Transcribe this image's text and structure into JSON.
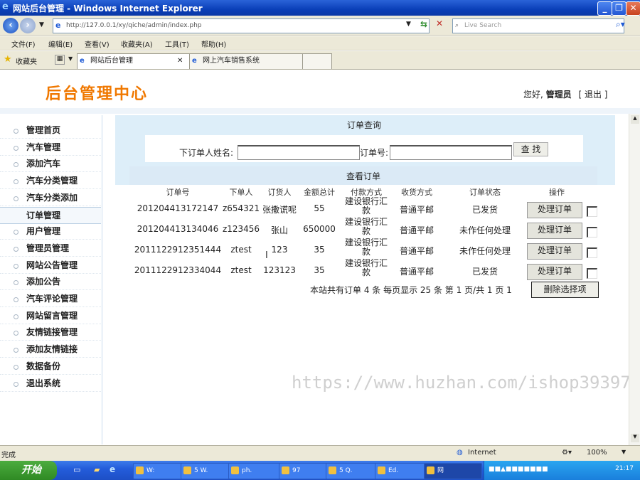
{
  "window": {
    "title": "网站后台管理 - Windows Internet Explorer"
  },
  "addressbar": {
    "url": "http://127.0.0.1/xy/qiche/admin/index.php",
    "search_placeholder": "Live Search"
  },
  "menu": [
    "文件(F)",
    "编辑(E)",
    "查看(V)",
    "收藏夹(A)",
    "工具(T)",
    "帮助(H)"
  ],
  "favorites_label": "收藏夹",
  "tabs": [
    "网站后台管理",
    "网上汽车销售系统"
  ],
  "header": {
    "logo": "后台管理中心",
    "greeting": "您好,",
    "user": "管理员",
    "logout": "[ 退出 ]"
  },
  "sidebar": {
    "items": [
      "管理首页",
      "汽车管理",
      "添加汽车",
      "汽车分类管理",
      "汽车分类添加",
      "订单管理",
      "用户管理",
      "管理员管理",
      "网站公告管理",
      "添加公告",
      "汽车评论管理",
      "网站留言管理",
      "友情链接管理",
      "添加友情链接",
      "数据备份",
      "退出系统"
    ],
    "active_index": 5
  },
  "query": {
    "title": "订单查询",
    "name_label": "下订单人姓名:",
    "order_label": "订单号:",
    "search_button": "查 找"
  },
  "orders": {
    "title": "查看订单",
    "columns": [
      "订单号",
      "下单人",
      "订货人",
      "金额总计",
      "付款方式",
      "收货方式",
      "订单状态",
      "操作"
    ],
    "rows": [
      [
        "201204413172147",
        "z654321",
        "张撒谎呢",
        "55",
        "建设银行汇款",
        "普通平邮",
        "已发货",
        "处理订单"
      ],
      [
        "201204413134046",
        "z123456",
        "张山",
        "650000",
        "建设银行汇款",
        "普通平邮",
        "未作任何处理",
        "处理订单"
      ],
      [
        "2011122912351444",
        "ztest",
        "123",
        "35",
        "建设银行汇款",
        "普通平邮",
        "未作任何处理",
        "处理订单"
      ],
      [
        "2011122912334044",
        "ztest",
        "123123",
        "35",
        "建设银行汇款",
        "普通平邮",
        "已发货",
        "处理订单"
      ]
    ],
    "footer": "本站共有订单 4 条 每页显示 25 条 第 1 页/共 1 页 1",
    "delete_button": "删除选择项"
  },
  "watermark": "https://www.huzhan.com/ishop39397",
  "status": {
    "left": "完成",
    "zone": "Internet",
    "zoom": "100%"
  },
  "taskbar": {
    "start": "开始",
    "tasks": [
      "W:",
      "5 W.",
      "ph.",
      "97",
      "5 Q.",
      "Ed.",
      "网"
    ],
    "clock": "21:17"
  }
}
